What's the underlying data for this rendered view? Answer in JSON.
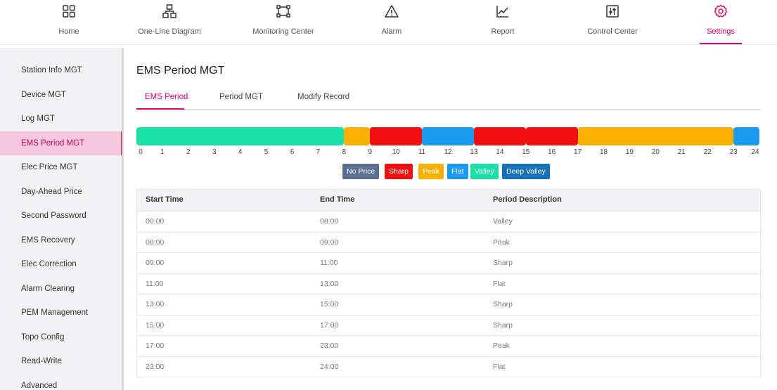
{
  "nav": {
    "items": [
      {
        "label": "Home",
        "icon": "grid-icon"
      },
      {
        "label": "One-Line Diagram",
        "icon": "network-icon"
      },
      {
        "label": "Monitoring Center",
        "icon": "monitor-icon"
      },
      {
        "label": "Alarm",
        "icon": "warning-icon"
      },
      {
        "label": "Report",
        "icon": "line-chart-icon"
      },
      {
        "label": "Control Center",
        "icon": "sliders-icon"
      },
      {
        "label": "Settings",
        "icon": "gear-icon",
        "active": true
      }
    ],
    "accent": "#e0006c"
  },
  "sidebar": {
    "items": [
      {
        "label": "Station Info MGT"
      },
      {
        "label": "Device MGT"
      },
      {
        "label": "Log MGT"
      },
      {
        "label": "EMS Period MGT",
        "active": true
      },
      {
        "label": "Elec Price MGT"
      },
      {
        "label": "Day-Ahead Price"
      },
      {
        "label": "Second Password"
      },
      {
        "label": "EMS Recovery"
      },
      {
        "label": "Elec Correction"
      },
      {
        "label": "Alarm Clearing"
      },
      {
        "label": "PEM Management"
      },
      {
        "label": "Topo Config"
      },
      {
        "label": "Read-Write"
      },
      {
        "label": "Advanced"
      }
    ]
  },
  "main": {
    "title": "EMS Period MGT",
    "tabs": [
      {
        "label": "EMS Period",
        "active": true
      },
      {
        "label": "Period MGT"
      },
      {
        "label": "Modify Record"
      }
    ]
  },
  "timeline": {
    "ticks": [
      "0",
      "1",
      "2",
      "3",
      "4",
      "5",
      "6",
      "7",
      "8",
      "9",
      "10",
      "11",
      "12",
      "13",
      "14",
      "15",
      "16",
      "17",
      "18",
      "19",
      "20",
      "21",
      "22",
      "23",
      "24"
    ],
    "segments": [
      {
        "start": 0,
        "end": 8,
        "type": "Valley"
      },
      {
        "start": 8,
        "end": 9,
        "type": "Peak"
      },
      {
        "start": 9,
        "end": 11,
        "type": "Sharp"
      },
      {
        "start": 11,
        "end": 13,
        "type": "Flat"
      },
      {
        "start": 13,
        "end": 15,
        "type": "Sharp"
      },
      {
        "start": 15,
        "end": 17,
        "type": "Sharp"
      },
      {
        "start": 17,
        "end": 23,
        "type": "Peak"
      },
      {
        "start": 23,
        "end": 24,
        "type": "Flat"
      }
    ]
  },
  "legend": [
    {
      "label": "No Price",
      "color": "#5b6e94"
    },
    {
      "label": "Sharp",
      "color": "#f01010"
    },
    {
      "label": "Peak",
      "color": "#fcb100"
    },
    {
      "label": "Flat",
      "color": "#1a9bf0"
    },
    {
      "label": "Valley",
      "color": "#19e0a6"
    },
    {
      "label": "Deep Valley",
      "color": "#1670b8"
    }
  ],
  "table": {
    "headers": [
      "Start Time",
      "End Time",
      "Period Description"
    ],
    "rows": [
      [
        "00:00",
        "08:00",
        "Valley"
      ],
      [
        "08:00",
        "09:00",
        "Peak"
      ],
      [
        "09:00",
        "11:00",
        "Sharp"
      ],
      [
        "11:00",
        "13:00",
        "Flat"
      ],
      [
        "13:00",
        "15:00",
        "Sharp"
      ],
      [
        "15:00",
        "17:00",
        "Sharp"
      ],
      [
        "17:00",
        "23:00",
        "Peak"
      ],
      [
        "23:00",
        "24:00",
        "Flat"
      ]
    ]
  }
}
